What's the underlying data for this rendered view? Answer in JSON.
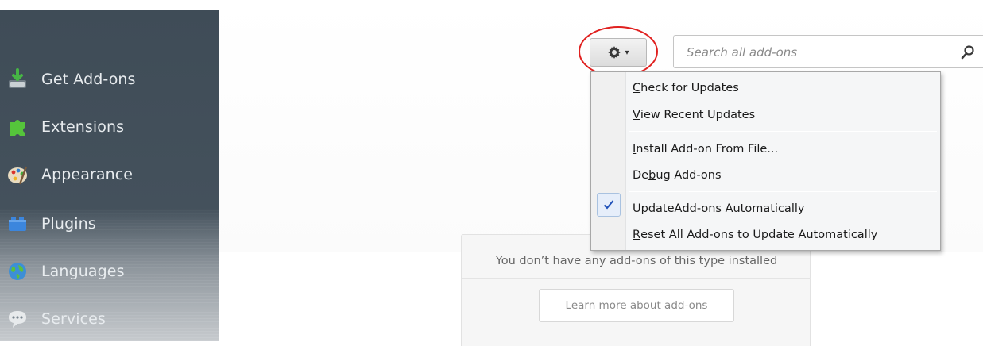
{
  "sidebar": {
    "items": [
      {
        "label": "Get Add-ons",
        "icon": "get-addons-icon"
      },
      {
        "label": "Extensions",
        "icon": "puzzle-piece-icon"
      },
      {
        "label": "Appearance",
        "icon": "palette-icon"
      },
      {
        "label": "Plugins",
        "icon": "plugin-brick-icon"
      },
      {
        "label": "Languages",
        "icon": "globe-icon"
      },
      {
        "label": "Services",
        "icon": "chat-bubble-icon"
      }
    ]
  },
  "toolbar": {
    "gear_icon": "gear-icon",
    "search": {
      "placeholder": "Search all add-ons",
      "value": ""
    }
  },
  "menu": {
    "items": [
      {
        "pre": "",
        "key": "C",
        "post": "heck for Updates",
        "checked": false
      },
      {
        "pre": "",
        "key": "V",
        "post": "iew Recent Updates",
        "checked": false
      },
      {
        "pre": "",
        "key": "I",
        "post": "nstall Add-on From File...",
        "checked": false
      },
      {
        "pre": "De",
        "key": "b",
        "post": "ug Add-ons",
        "checked": false
      },
      {
        "pre": "Update ",
        "key": "A",
        "post": "dd-ons Automatically",
        "checked": true
      },
      {
        "pre": "",
        "key": "R",
        "post": "eset All Add-ons to Update Automatically",
        "checked": false
      }
    ]
  },
  "empty_state": {
    "message": "You don’t have any add-ons of this type installed",
    "learn_more": "Learn more about add-ons"
  },
  "colors": {
    "sidebar_bg": "#44515c",
    "highlight_ring": "#e0201f",
    "menu_bg": "#f5f6f7",
    "check_color": "#1d4fb8"
  }
}
